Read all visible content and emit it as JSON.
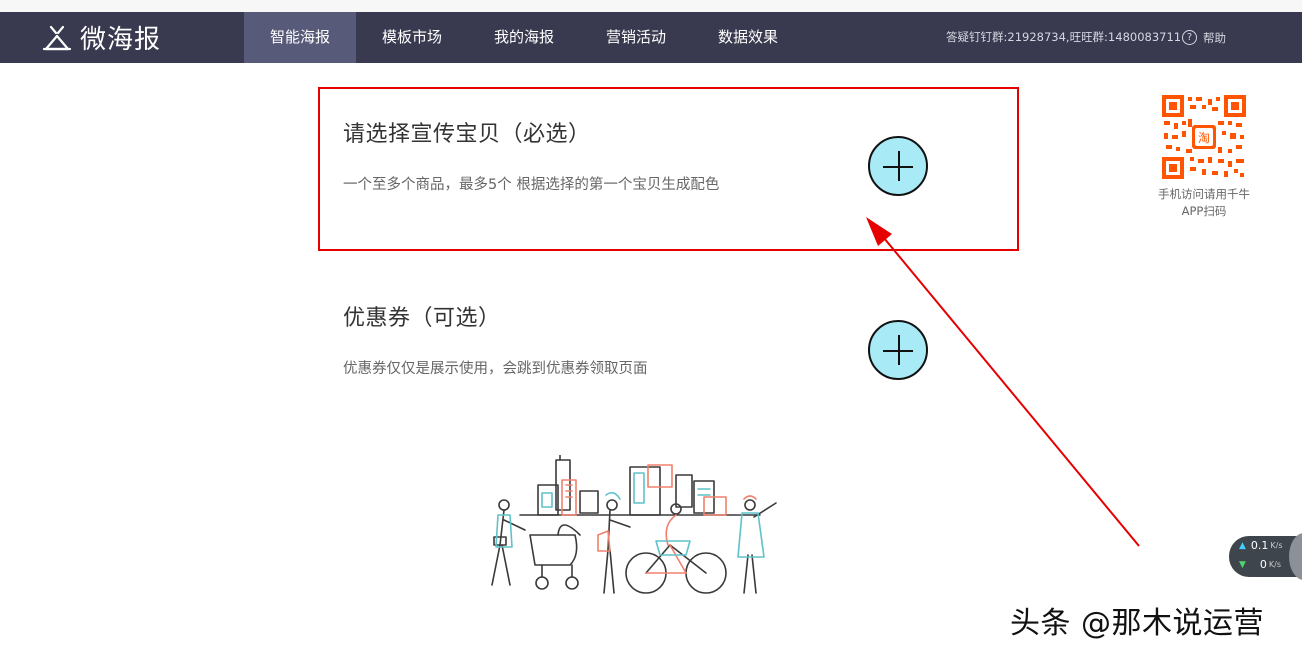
{
  "app": {
    "logo_text": "微海报"
  },
  "nav": {
    "items": [
      {
        "label": "智能海报",
        "active": true
      },
      {
        "label": "模板市场",
        "active": false
      },
      {
        "label": "我的海报",
        "active": false
      },
      {
        "label": "营销活动",
        "active": false
      },
      {
        "label": "数据效果",
        "active": false
      }
    ],
    "contact": "答疑钉钉群:21928734,旺旺群:1480083711",
    "help_icon": "?",
    "help_label": "帮助"
  },
  "sections": {
    "product": {
      "title": "请选择宣传宝贝（必选）",
      "desc": "一个至多个商品，最多5个 根据选择的第一个宝贝生成配色",
      "add_icon": "plus-circle-icon"
    },
    "coupon": {
      "title": "优惠券（可选）",
      "desc": "优惠券仅仅是展示使用，会跳到优惠券领取页面",
      "add_icon": "plus-circle-icon"
    }
  },
  "qr": {
    "center_label": "淘",
    "caption_line1": "手机访问请用千牛",
    "caption_line2": "APP扫码"
  },
  "speed_widget": {
    "up_value": "0.1",
    "up_unit": "K/s",
    "down_value": "0",
    "down_unit": "K/s"
  },
  "watermark": "头条 @那木说运营",
  "colors": {
    "navbar_bg": "#393a4f",
    "nav_active_bg": "#585a7a",
    "add_button_fill": "#a8ebf7",
    "annotation_red": "#e60000"
  }
}
